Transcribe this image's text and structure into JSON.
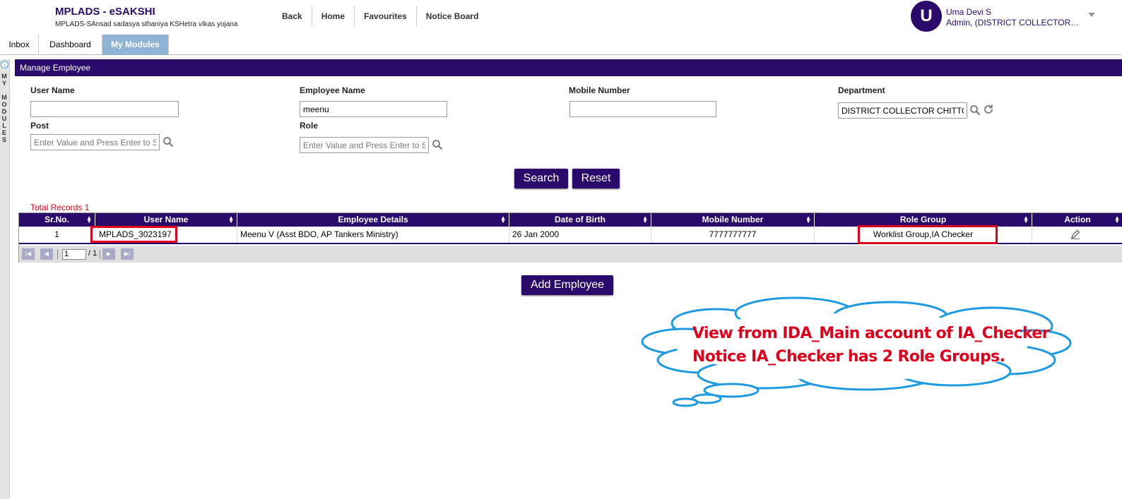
{
  "app": {
    "title": "MPLADS - eSAKSHI",
    "subtitle": "MPLADS-SAnsad sadasya sthaniya KSHetra vIkas yojana"
  },
  "topnav": [
    "Back",
    "Home",
    "Favourites",
    "Notice Board"
  ],
  "user": {
    "initial": "U",
    "name": "Uma Devi S",
    "role": "Admin, (DISTRICT COLLECTOR CHITTOOR)"
  },
  "tabs": [
    {
      "label": "Inbox",
      "active": false
    },
    {
      "label": "Dashboard",
      "active": false
    },
    {
      "label": "My Modules",
      "active": true
    }
  ],
  "rail": {
    "label": "MY\n\nMODULES"
  },
  "panel": {
    "title": "Manage Employee"
  },
  "form": {
    "user_name": {
      "label": "User Name",
      "value": ""
    },
    "employee_name": {
      "label": "Employee Name",
      "value": "meenu"
    },
    "mobile_number": {
      "label": "Mobile Number",
      "value": ""
    },
    "department": {
      "label": "Department",
      "value": "DISTRICT COLLECTOR CHITTOOR"
    },
    "post": {
      "label": "Post",
      "placeholder": "Enter Value and Press Enter to Search"
    },
    "role": {
      "label": "Role",
      "placeholder": "Enter Value and Press Enter to Search"
    },
    "search_label": "Search",
    "reset_label": "Reset"
  },
  "total_records": "Total Records 1",
  "grid": {
    "columns": [
      "Sr.No.",
      "User Name",
      "Employee Details",
      "Date of Birth",
      "Mobile Number",
      "Role Group",
      "Action"
    ],
    "rows": [
      {
        "sr": "1",
        "user_name": "MPLADS_3023197",
        "employee_details": "Meenu V (Asst BDO, AP Tankers Ministry)",
        "dob": "26 Jan 2000",
        "mobile": "7777777777",
        "role_group": "Worklist Group,IA Checker"
      }
    ],
    "pager": {
      "page": "1",
      "total": "/ 1"
    }
  },
  "add_employee_label": "Add Employee",
  "annotation": {
    "line1": "View from IDA_Main account of IA_Checker",
    "line2": "Notice IA_Checker has 2 Role Groups."
  },
  "colors": {
    "brand": "#2a0a6b",
    "active_tab": "#8fb3d4",
    "highlight": "#e0001b",
    "cloud": "#1e9be0"
  }
}
